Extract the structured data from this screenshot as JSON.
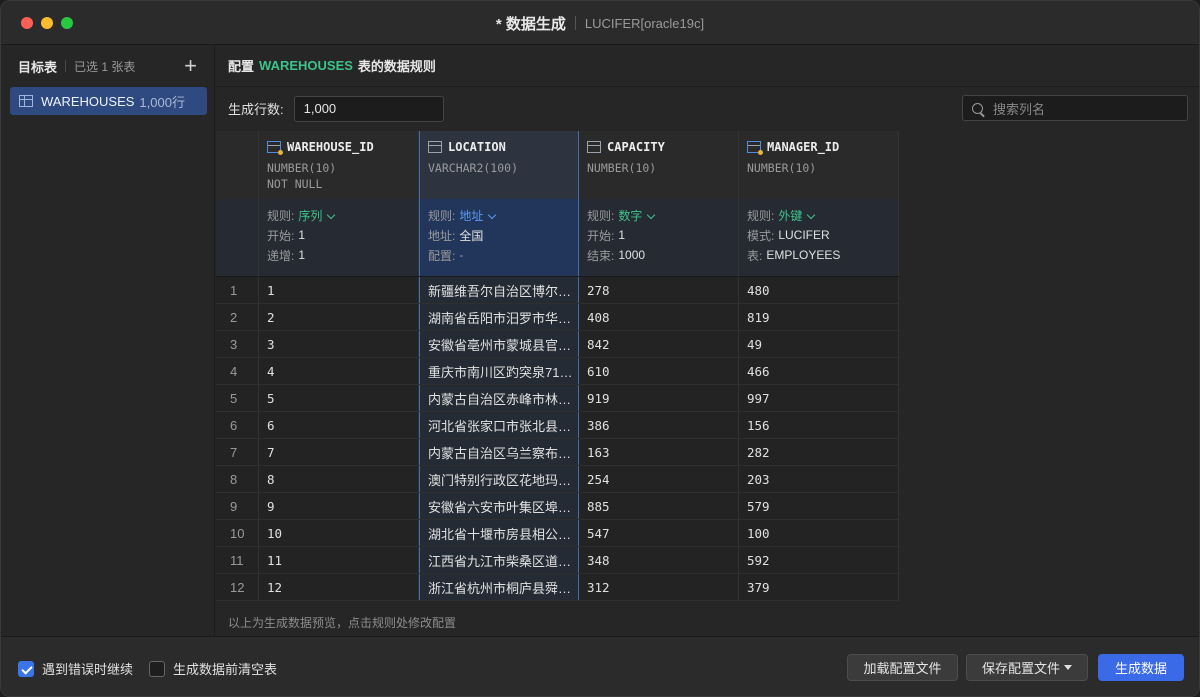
{
  "window": {
    "title": "* 数据生成",
    "subtitle": "LUCIFER[oracle19c]"
  },
  "sidebar": {
    "title": "目标表",
    "selected_count": "已选 1 张表",
    "add_label": "+",
    "items": [
      {
        "name": "WAREHOUSES",
        "rows": "1,000行"
      }
    ]
  },
  "config": {
    "prefix": "配置",
    "table": "WAREHOUSES",
    "suffix": "表的数据规则",
    "rows_label": "生成行数:",
    "rows_value": "1,000",
    "search_placeholder": "搜索列名"
  },
  "columns": [
    {
      "name": "WAREHOUSE_ID",
      "type": "NUMBER(10)",
      "constraint": "NOT NULL",
      "rules": [
        {
          "k": "规则:",
          "v": "序列"
        },
        {
          "k": "开始:",
          "v": "1"
        },
        {
          "k": "递增:",
          "v": "1"
        }
      ]
    },
    {
      "name": "LOCATION",
      "type": "VARCHAR2(100)",
      "constraint": "",
      "rules": [
        {
          "k": "规则:",
          "v": "地址"
        },
        {
          "k": "地址:",
          "v": "全国"
        },
        {
          "k": "配置:",
          "v": "-"
        }
      ]
    },
    {
      "name": "CAPACITY",
      "type": "NUMBER(10)",
      "constraint": "",
      "rules": [
        {
          "k": "规则:",
          "v": "数字"
        },
        {
          "k": "开始:",
          "v": "1"
        },
        {
          "k": "结束:",
          "v": "1000"
        }
      ]
    },
    {
      "name": "MANAGER_ID",
      "type": "NUMBER(10)",
      "constraint": "",
      "rules": [
        {
          "k": "规则:",
          "v": "外键"
        },
        {
          "k": "模式:",
          "v": "LUCIFER"
        },
        {
          "k": "表:",
          "v": "EMPLOYEES"
        }
      ]
    }
  ],
  "rows": [
    [
      "1",
      "1",
      "新疆维吾尔自治区博尔…",
      "278",
      "480"
    ],
    [
      "2",
      "2",
      "湖南省岳阳市汨罗市华…",
      "408",
      "819"
    ],
    [
      "3",
      "3",
      "安徽省亳州市蒙城县官…",
      "842",
      "49"
    ],
    [
      "4",
      "4",
      "重庆市南川区趵突泉71…",
      "610",
      "466"
    ],
    [
      "5",
      "5",
      "内蒙古自治区赤峰市林…",
      "919",
      "997"
    ],
    [
      "6",
      "6",
      "河北省张家口市张北县…",
      "386",
      "156"
    ],
    [
      "7",
      "7",
      "内蒙古自治区乌兰察布…",
      "163",
      "282"
    ],
    [
      "8",
      "8",
      "澳门特别行政区花地玛…",
      "254",
      "203"
    ],
    [
      "9",
      "9",
      "安徽省六安市叶集区埠…",
      "885",
      "579"
    ],
    [
      "10",
      "10",
      "湖北省十堰市房县相公…",
      "547",
      "100"
    ],
    [
      "11",
      "11",
      "江西省九江市柴桑区道…",
      "348",
      "592"
    ],
    [
      "12",
      "12",
      "浙江省杭州市桐庐县舜…",
      "312",
      "379"
    ]
  ],
  "hint": "以上为生成数据预览，点击规则处修改配置",
  "footer": {
    "continue_on_error": "遇到错误时继续",
    "continue_checked": true,
    "truncate_before": "生成数据前清空表",
    "truncate_checked": false,
    "load_config": "加载配置文件",
    "save_config": "保存配置文件",
    "generate": "生成数据"
  }
}
